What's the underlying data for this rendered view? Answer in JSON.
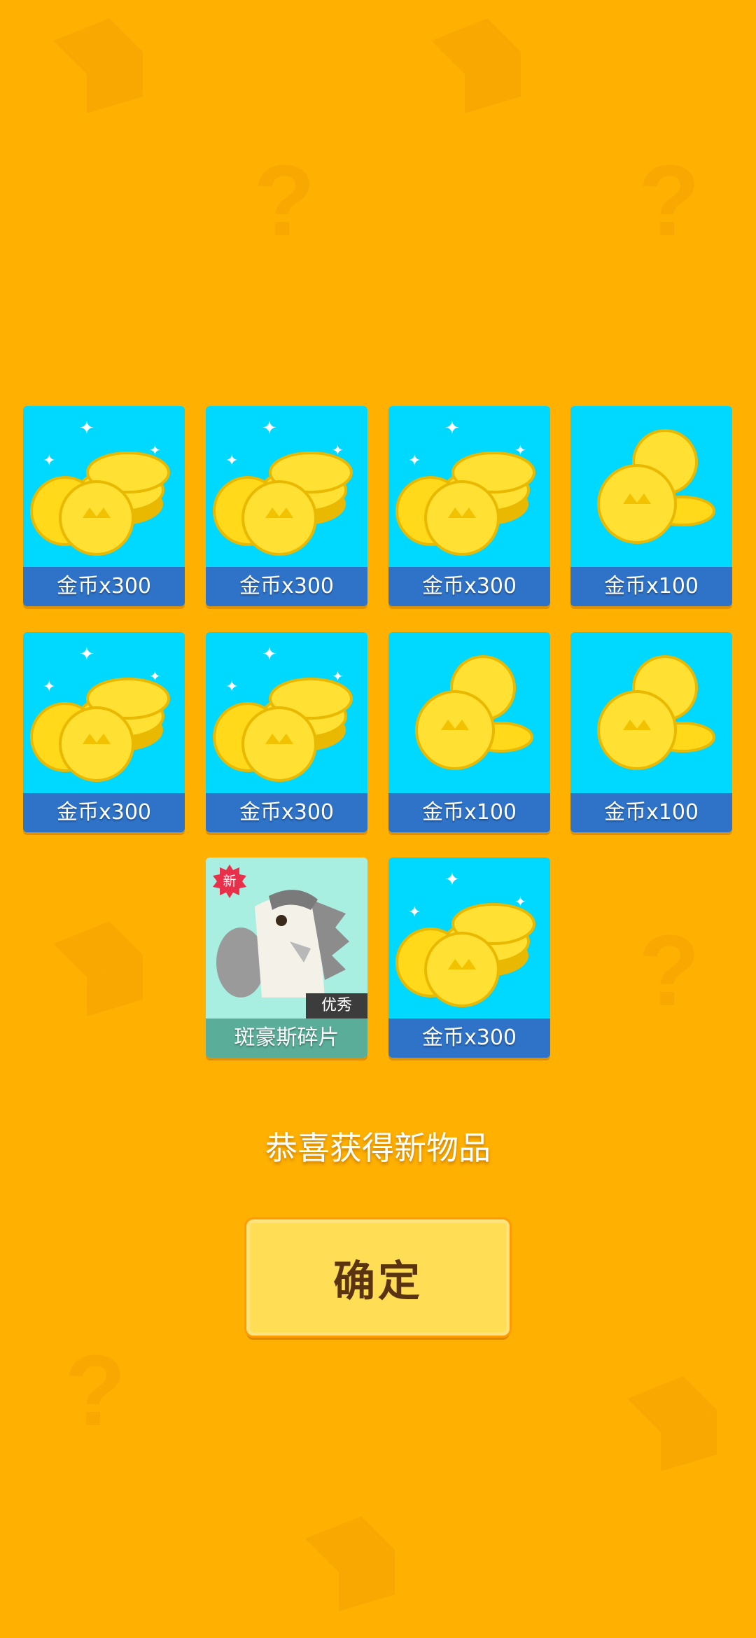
{
  "rewards": [
    {
      "label": "金币x300",
      "kind": "coins-large"
    },
    {
      "label": "金币x300",
      "kind": "coins-large"
    },
    {
      "label": "金币x300",
      "kind": "coins-large"
    },
    {
      "label": "金币x100",
      "kind": "coins-small"
    },
    {
      "label": "金币x300",
      "kind": "coins-large"
    },
    {
      "label": "金币x300",
      "kind": "coins-large"
    },
    {
      "label": "金币x100",
      "kind": "coins-small"
    },
    {
      "label": "金币x100",
      "kind": "coins-small"
    },
    {
      "label": "斑豪斯碎片",
      "kind": "character-piece",
      "rarity": "优秀",
      "badge": "新"
    },
    {
      "label": "金币x300",
      "kind": "coins-large"
    }
  ],
  "message": "恭喜获得新物品",
  "confirm_label": "确定",
  "colors": {
    "background": "#FFB000",
    "card_bg": "#00D9FF",
    "card_label_bg": "#2F73C8",
    "piece_bg": "#A8EFE2",
    "piece_label_bg": "#5AAE99",
    "button_bg": "#FFDD55",
    "button_text": "#5A3410",
    "new_badge": "#E8304A"
  }
}
